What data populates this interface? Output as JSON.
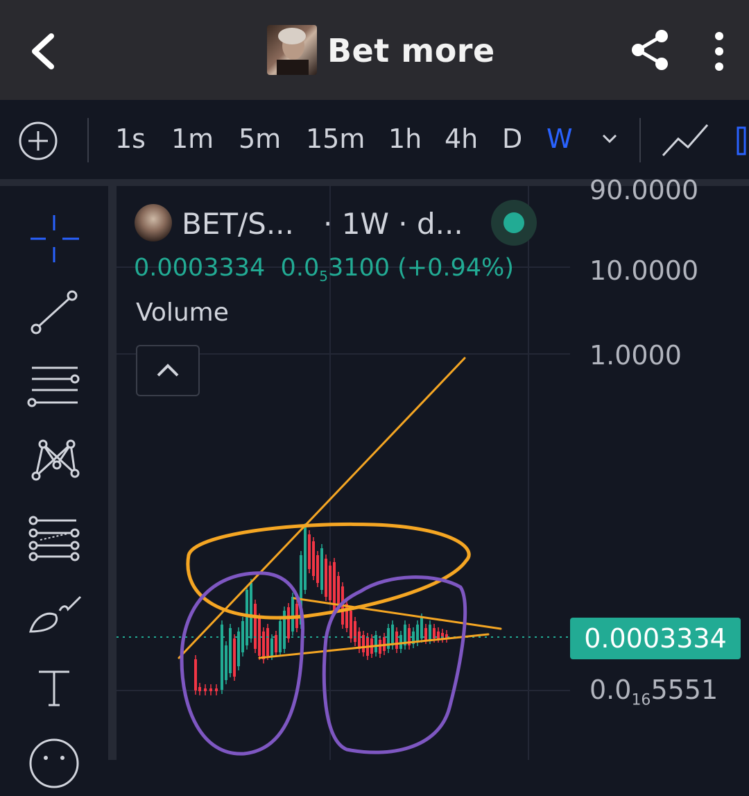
{
  "header": {
    "title": "Bet more"
  },
  "toolbar": {
    "timeframes": [
      "1s",
      "1m",
      "5m",
      "15m",
      "1h",
      "4h",
      "D",
      "W"
    ],
    "active_timeframe": "W"
  },
  "legend": {
    "symbol": "BET/S...",
    "interval": "· 1W · d...",
    "price": "0.0003334",
    "change_prefix": "0.0",
    "change_sub": "5",
    "change_suffix": "3100 (+0.94%)",
    "volume_label": "Volume"
  },
  "price_axis": {
    "labels": [
      "90.0000",
      "10.0000",
      "1.0000"
    ],
    "bottom_prefix": "0.0",
    "bottom_sub": "16",
    "bottom_suffix": "5551",
    "current_price": "0.0003334"
  },
  "colors": {
    "up": "#22ab94",
    "down": "#f23645",
    "active": "#2962ff",
    "annotation_orange": "#f5a623",
    "annotation_purple": "#7e57c2"
  },
  "icons": [
    "back-icon",
    "share-icon",
    "more-icon",
    "add-icon",
    "chevron-down-icon",
    "line-chart-icon",
    "crosshair-icon",
    "trendline-icon",
    "horizontal-lines-icon",
    "pattern-icon",
    "fib-icon",
    "brush-icon",
    "text-icon",
    "emoji-icon",
    "chevron-up-icon"
  ]
}
